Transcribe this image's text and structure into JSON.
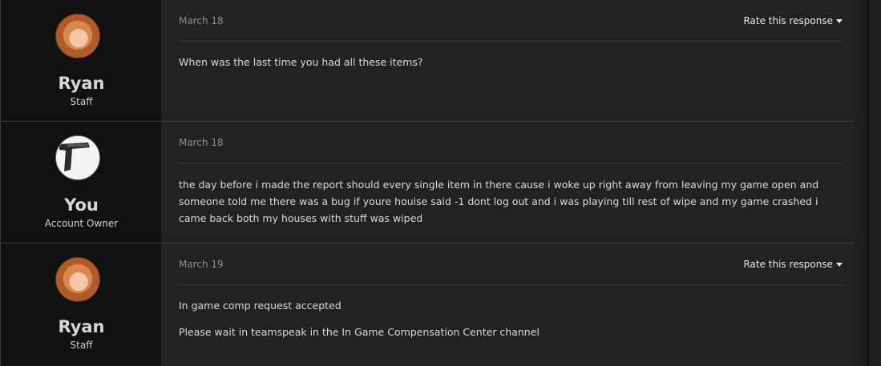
{
  "posts": [
    {
      "author": {
        "name": "Ryan",
        "role": "Staff",
        "avatar": "ryan-avatar"
      },
      "date": "March 18",
      "rate_label": "Rate this response",
      "messages": [
        "When was the last time you had all these items?"
      ]
    },
    {
      "author": {
        "name": "You",
        "role": "Account Owner",
        "avatar": "user-gun-avatar"
      },
      "date": "March 18",
      "messages": [
        "the day before i made the report should every single item in there cause i woke up right away from leaving my game open and someone told me there was a bug if youre houise said -1 dont log out and i was playing till rest of wipe and my game crashed i came back both my houses with stuff was wiped"
      ]
    },
    {
      "author": {
        "name": "Ryan",
        "role": "Staff",
        "avatar": "ryan-avatar"
      },
      "date": "March 19",
      "rate_label": "Rate this response",
      "messages": [
        "In game comp request accepted",
        "Please wait in teamspeak in the In Game Compensation Center channel"
      ]
    }
  ],
  "colors": {
    "author_bg": "#111111",
    "content_bg": "#222222",
    "page_bg": "#2a2a2a"
  }
}
